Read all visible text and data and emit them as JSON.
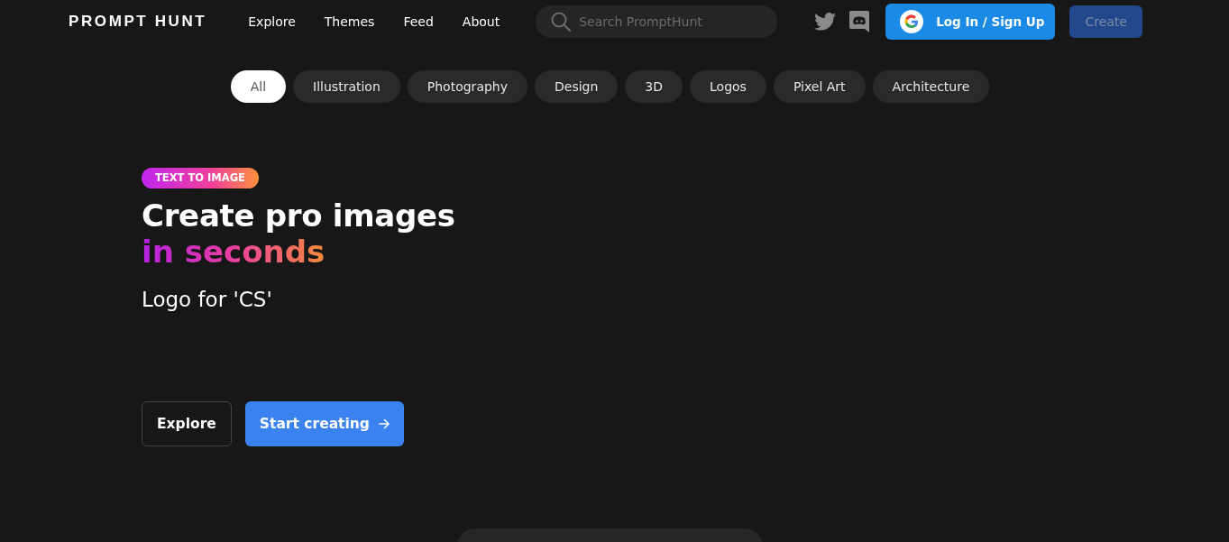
{
  "header": {
    "logo": "PROMPT HUNT",
    "nav": [
      "Explore",
      "Themes",
      "Feed",
      "About"
    ],
    "search": {
      "placeholder": "Search PromptHunt"
    },
    "login_button": "Log In / Sign Up",
    "create_button": {
      "label": "Create",
      "disabled": true
    }
  },
  "categories": [
    {
      "label": "All",
      "selected": true
    },
    {
      "label": "Illustration",
      "selected": false
    },
    {
      "label": "Photography",
      "selected": false
    },
    {
      "label": "Design",
      "selected": false
    },
    {
      "label": "3D",
      "selected": false
    },
    {
      "label": "Logos",
      "selected": false
    },
    {
      "label": "Pixel Art",
      "selected": false
    },
    {
      "label": "Architecture",
      "selected": false
    }
  ],
  "hero": {
    "badge": "TEXT TO IMAGE",
    "title_line_1": "Create pro images",
    "title_line_2": "in seconds",
    "example_prompt": "Logo for 'CS'",
    "buttons": [
      {
        "label": "Explore",
        "kind": "outline"
      },
      {
        "label": "Start creating",
        "kind": "primary"
      }
    ]
  }
}
